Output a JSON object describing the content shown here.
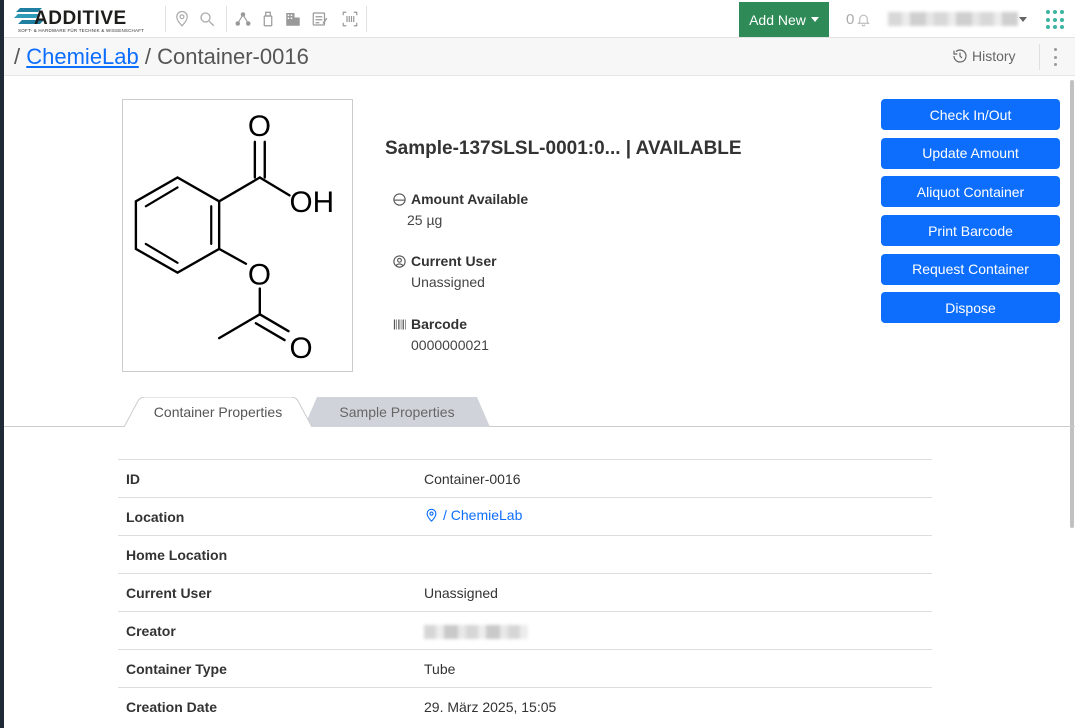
{
  "nav": {
    "brand": "ADDITIVE",
    "brand_sub": "SOFT- & HARDWARE FÜR TECHNIK & WISSENSCHAFT",
    "add_new_label": "Add New",
    "notification_count": "0",
    "accent": "#2e8b57"
  },
  "breadcrumb": {
    "sep1": "/",
    "location": "ChemieLab",
    "sep2": "/",
    "current": "Container-0016"
  },
  "history_label": "History",
  "container": {
    "title": "Sample-137SLSL-0001:0... | AVAILABLE",
    "amount_label": "Amount Available",
    "amount_value": "25 µg",
    "user_label": "Current User",
    "user_value": "Unassigned",
    "barcode_label": "Barcode",
    "barcode_value": "0000000021"
  },
  "actions": [
    "Check In/Out",
    "Update Amount",
    "Aliquot Container",
    "Print Barcode",
    "Request Container",
    "Dispose"
  ],
  "tabs": {
    "active": "Container Properties",
    "inactive": "Sample Properties"
  },
  "properties": [
    {
      "key": "ID",
      "value": "Container-0016"
    },
    {
      "key": "Location",
      "value": "/ ChemieLab"
    },
    {
      "key": "Home Location",
      "value": ""
    },
    {
      "key": "Current User",
      "value": "Unassigned"
    },
    {
      "key": "Creator",
      "value": ""
    },
    {
      "key": "Container Type",
      "value": "Tube"
    },
    {
      "key": "Creation Date",
      "value": "29. März 2025, 15:05"
    }
  ],
  "structure_atoms": {
    "o1": "O",
    "oh": "OH",
    "o2": "O",
    "o3": "O"
  },
  "colors": {
    "primary": "#0d6efd",
    "tab_inactive": "#d0d4da"
  }
}
